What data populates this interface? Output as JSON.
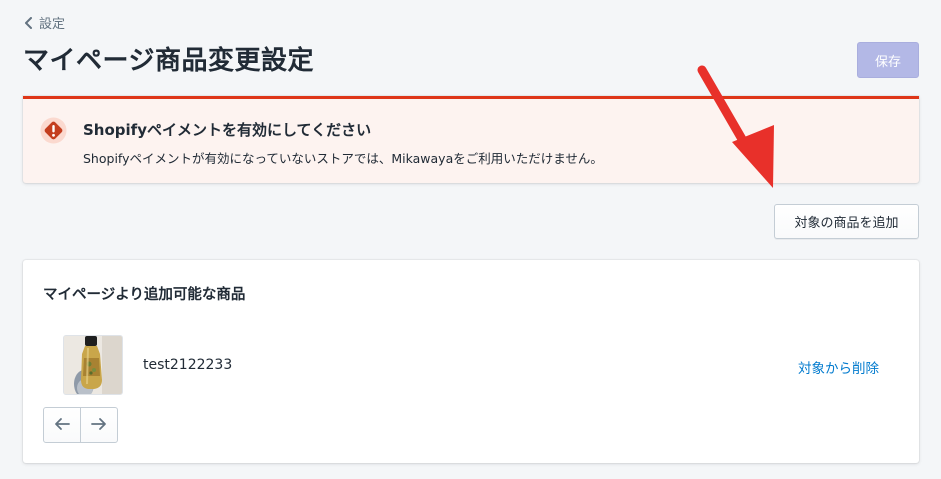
{
  "breadcrumb": {
    "label": "設定",
    "icon": "chevron-left-icon"
  },
  "page": {
    "title": "マイページ商品変更設定"
  },
  "toolbar": {
    "save_label": "保存",
    "save_disabled": true
  },
  "banner": {
    "status": "critical",
    "icon": "alert-diamond-icon",
    "title": "Shopifyペイメントを有効にしてください",
    "message": "Shopifyペイメントが有効になっていないストアでは、Mikawayaをご利用いただけません。"
  },
  "actions": {
    "add_product_label": "対象の商品を追加"
  },
  "card": {
    "title": "マイページより追加可能な商品",
    "products": [
      {
        "name": "test2122233",
        "remove_label": "対象から削除"
      }
    ],
    "pagination": {
      "prev_icon": "arrow-left-icon",
      "next_icon": "arrow-right-icon"
    }
  },
  "colors": {
    "critical": "#de3618",
    "link": "#007ace",
    "primary_disabled": "#b3b8e6",
    "annotation_arrow": "#e8302a"
  }
}
